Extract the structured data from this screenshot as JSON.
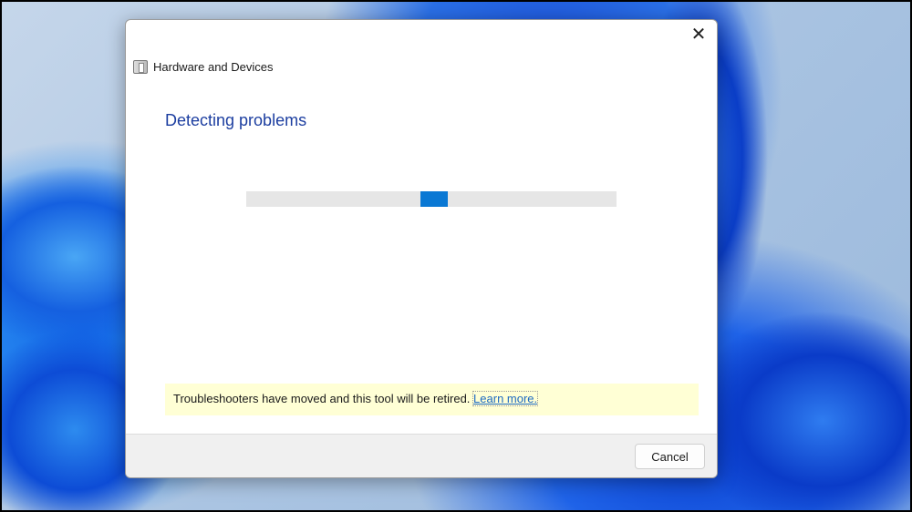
{
  "dialog": {
    "app_title": "Hardware and Devices",
    "heading": "Detecting problems",
    "progress": {
      "indeterminate": true,
      "block_position_fraction": 0.47
    },
    "info_text": "Troubleshooters have moved and this tool will be retired.",
    "info_link": "Learn more.",
    "cancel_label": "Cancel",
    "close_glyph": "✕"
  },
  "colors": {
    "accent": "#0a78d4",
    "heading": "#1c3ea0",
    "info_bg": "#ffffd5"
  }
}
